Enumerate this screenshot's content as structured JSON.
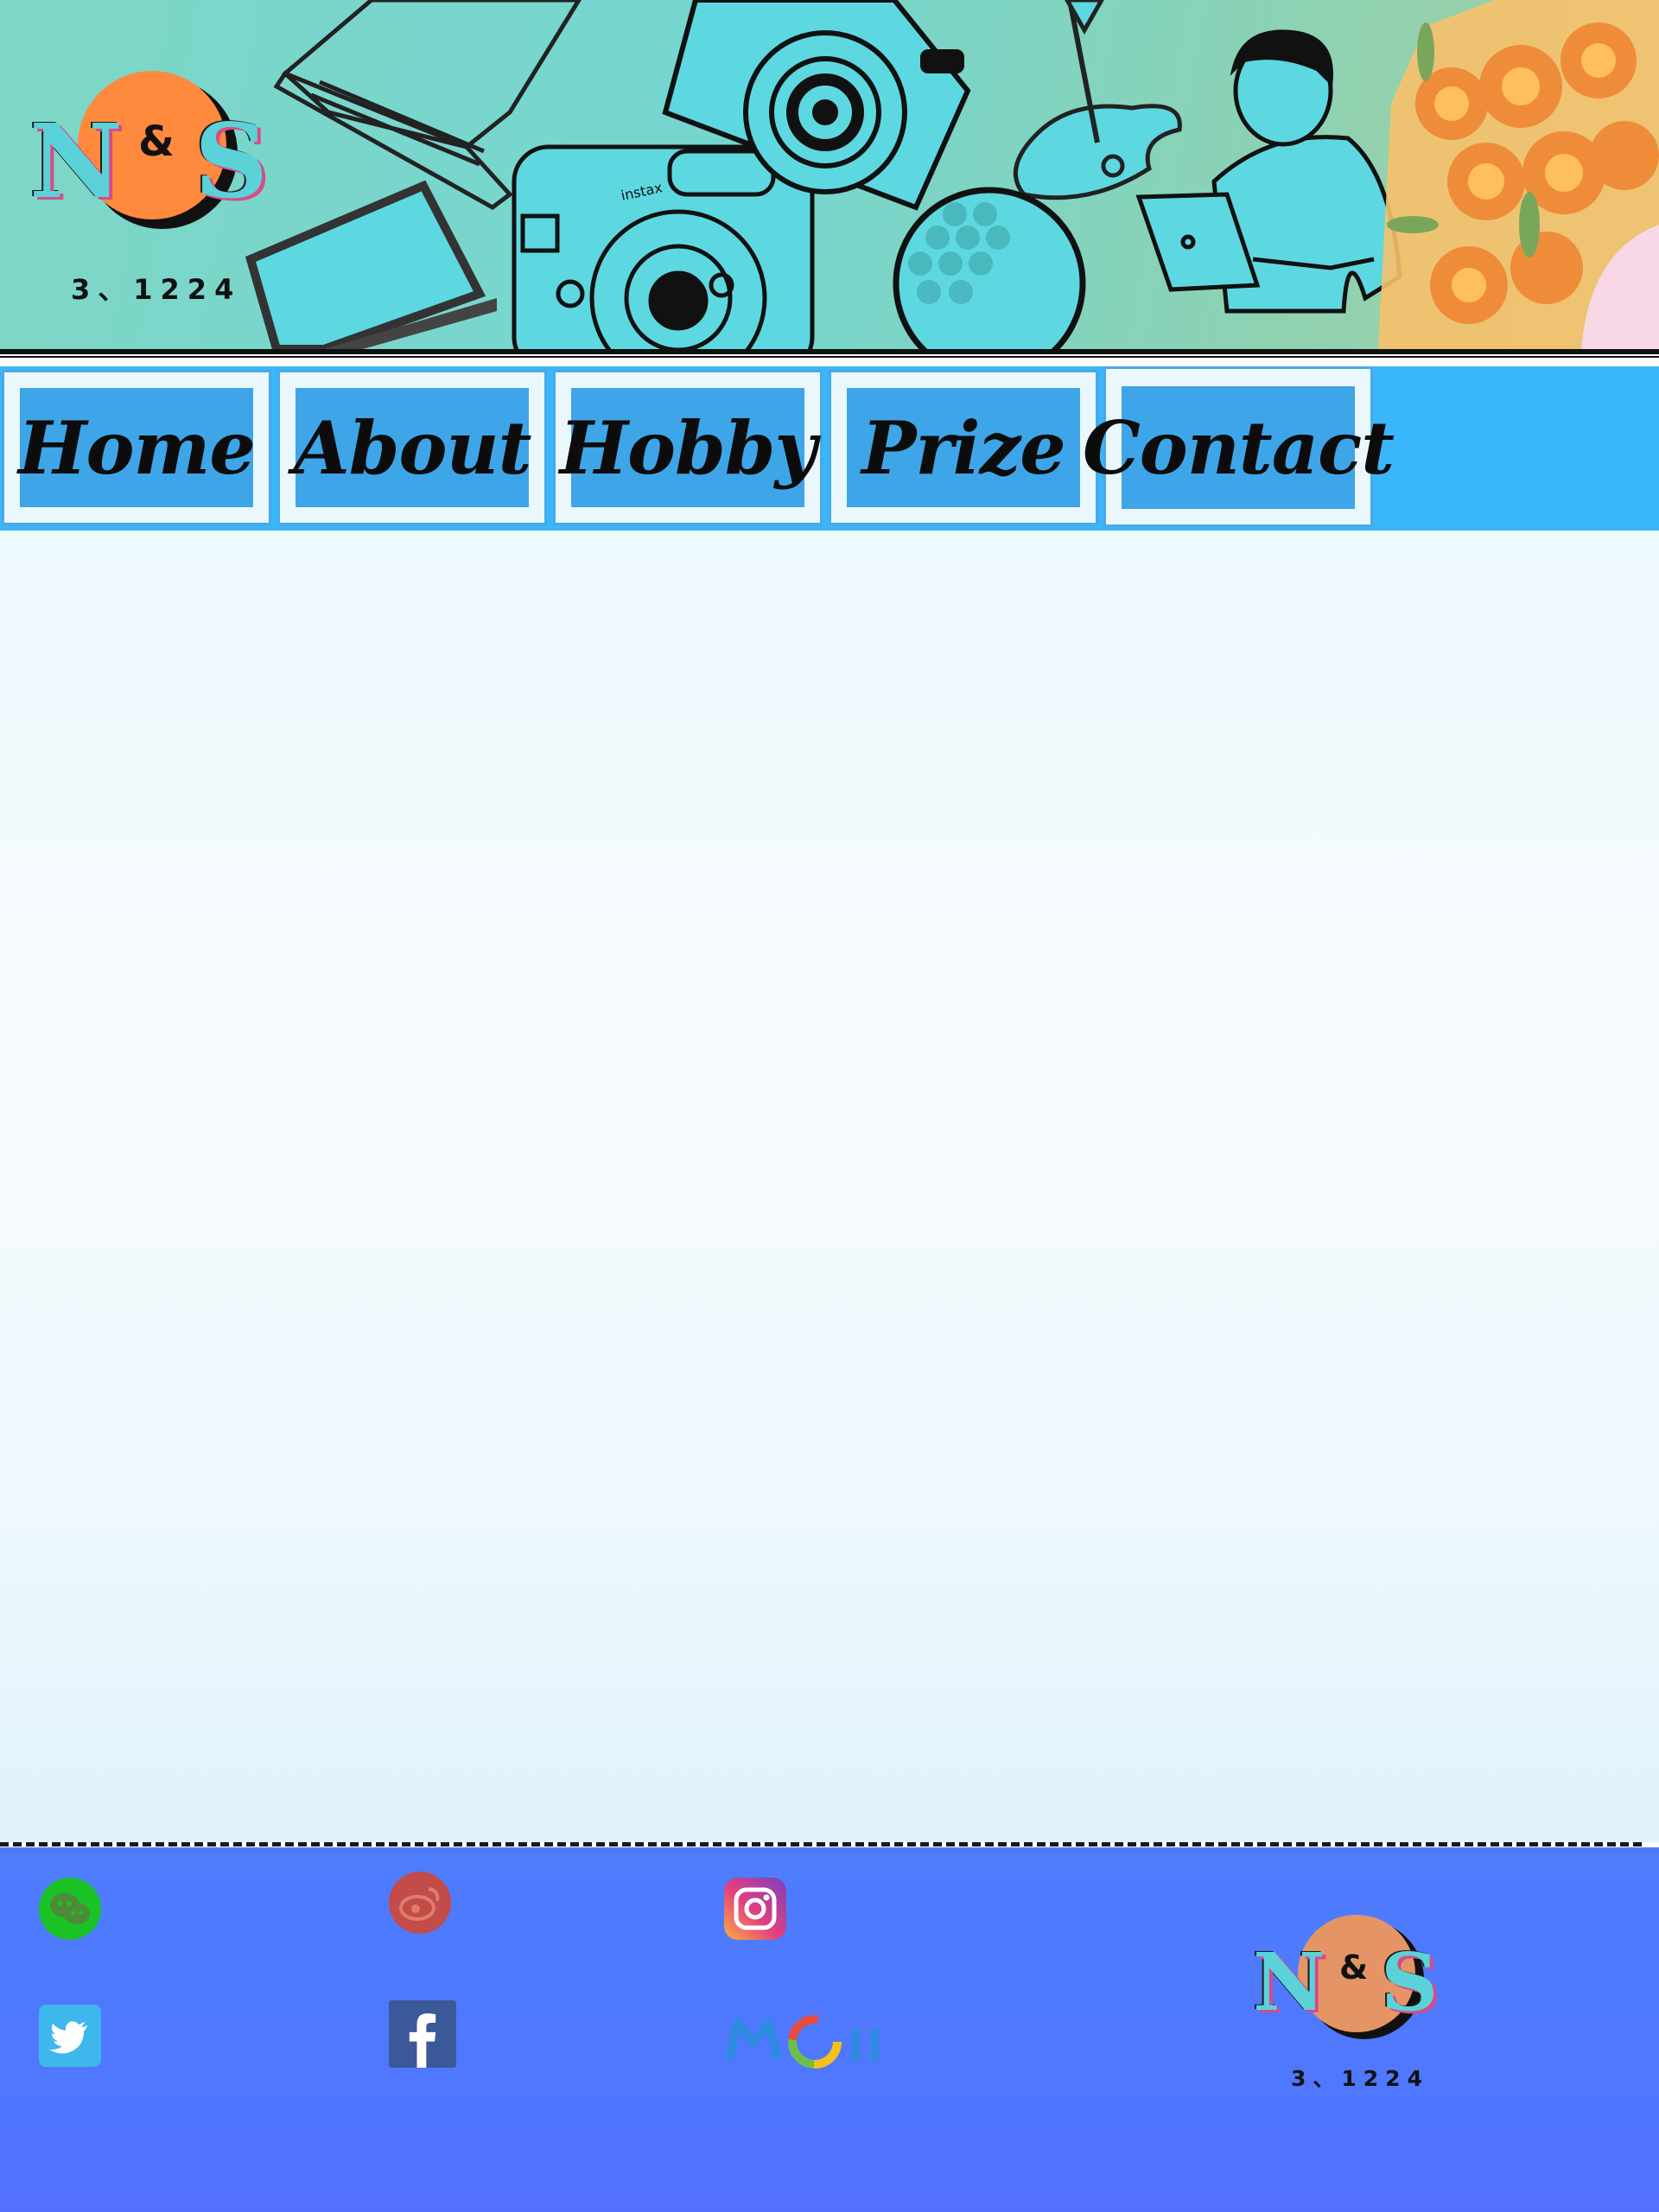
{
  "header": {
    "logo": {
      "left": "N",
      "amp": "&",
      "right": "S",
      "tagline": "3、1224"
    },
    "colors": {
      "sun": "#ff8a3d",
      "letters": "#5ad2d8",
      "letter_shadow": "#d84b8a"
    }
  },
  "nav": {
    "items": [
      {
        "label": "Home"
      },
      {
        "label": "About"
      },
      {
        "label": "Hobby"
      },
      {
        "label": "Prize"
      },
      {
        "label": "Contact"
      }
    ],
    "colors": {
      "bar": "#3ab6fb",
      "button": "#3ea5e8",
      "frame": "#eaf8fd"
    }
  },
  "footer": {
    "social": [
      {
        "icon": "wechat-icon"
      },
      {
        "icon": "weibo-icon"
      },
      {
        "icon": "instagram-icon"
      },
      {
        "icon": "twitter-icon"
      },
      {
        "icon": "facebook-icon"
      },
      {
        "icon": "moji-logo-icon",
        "text": "MOJI"
      }
    ],
    "logo": {
      "left": "N",
      "amp": "&",
      "right": "S",
      "tagline": "3、1224"
    },
    "colors": {
      "background": "#4f78ff"
    }
  }
}
